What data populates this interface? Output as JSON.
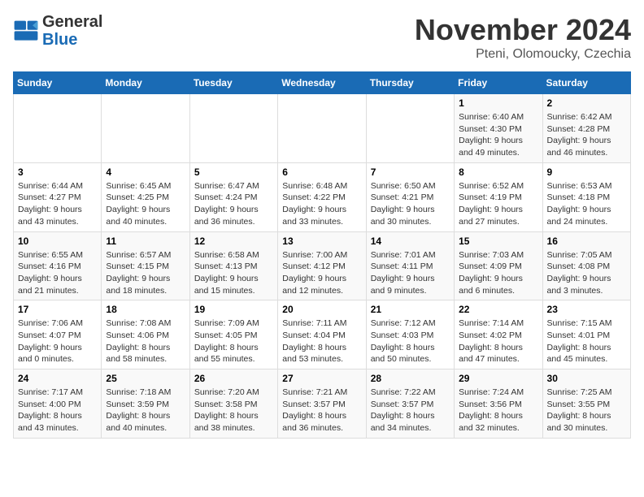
{
  "header": {
    "logo_line1": "General",
    "logo_line2": "Blue",
    "month": "November 2024",
    "location": "Pteni, Olomoucky, Czechia"
  },
  "days_of_week": [
    "Sunday",
    "Monday",
    "Tuesday",
    "Wednesday",
    "Thursday",
    "Friday",
    "Saturday"
  ],
  "weeks": [
    [
      {
        "day": "",
        "detail": ""
      },
      {
        "day": "",
        "detail": ""
      },
      {
        "day": "",
        "detail": ""
      },
      {
        "day": "",
        "detail": ""
      },
      {
        "day": "",
        "detail": ""
      },
      {
        "day": "1",
        "detail": "Sunrise: 6:40 AM\nSunset: 4:30 PM\nDaylight: 9 hours\nand 49 minutes."
      },
      {
        "day": "2",
        "detail": "Sunrise: 6:42 AM\nSunset: 4:28 PM\nDaylight: 9 hours\nand 46 minutes."
      }
    ],
    [
      {
        "day": "3",
        "detail": "Sunrise: 6:44 AM\nSunset: 4:27 PM\nDaylight: 9 hours\nand 43 minutes."
      },
      {
        "day": "4",
        "detail": "Sunrise: 6:45 AM\nSunset: 4:25 PM\nDaylight: 9 hours\nand 40 minutes."
      },
      {
        "day": "5",
        "detail": "Sunrise: 6:47 AM\nSunset: 4:24 PM\nDaylight: 9 hours\nand 36 minutes."
      },
      {
        "day": "6",
        "detail": "Sunrise: 6:48 AM\nSunset: 4:22 PM\nDaylight: 9 hours\nand 33 minutes."
      },
      {
        "day": "7",
        "detail": "Sunrise: 6:50 AM\nSunset: 4:21 PM\nDaylight: 9 hours\nand 30 minutes."
      },
      {
        "day": "8",
        "detail": "Sunrise: 6:52 AM\nSunset: 4:19 PM\nDaylight: 9 hours\nand 27 minutes."
      },
      {
        "day": "9",
        "detail": "Sunrise: 6:53 AM\nSunset: 4:18 PM\nDaylight: 9 hours\nand 24 minutes."
      }
    ],
    [
      {
        "day": "10",
        "detail": "Sunrise: 6:55 AM\nSunset: 4:16 PM\nDaylight: 9 hours\nand 21 minutes."
      },
      {
        "day": "11",
        "detail": "Sunrise: 6:57 AM\nSunset: 4:15 PM\nDaylight: 9 hours\nand 18 minutes."
      },
      {
        "day": "12",
        "detail": "Sunrise: 6:58 AM\nSunset: 4:13 PM\nDaylight: 9 hours\nand 15 minutes."
      },
      {
        "day": "13",
        "detail": "Sunrise: 7:00 AM\nSunset: 4:12 PM\nDaylight: 9 hours\nand 12 minutes."
      },
      {
        "day": "14",
        "detail": "Sunrise: 7:01 AM\nSunset: 4:11 PM\nDaylight: 9 hours\nand 9 minutes."
      },
      {
        "day": "15",
        "detail": "Sunrise: 7:03 AM\nSunset: 4:09 PM\nDaylight: 9 hours\nand 6 minutes."
      },
      {
        "day": "16",
        "detail": "Sunrise: 7:05 AM\nSunset: 4:08 PM\nDaylight: 9 hours\nand 3 minutes."
      }
    ],
    [
      {
        "day": "17",
        "detail": "Sunrise: 7:06 AM\nSunset: 4:07 PM\nDaylight: 9 hours\nand 0 minutes."
      },
      {
        "day": "18",
        "detail": "Sunrise: 7:08 AM\nSunset: 4:06 PM\nDaylight: 8 hours\nand 58 minutes."
      },
      {
        "day": "19",
        "detail": "Sunrise: 7:09 AM\nSunset: 4:05 PM\nDaylight: 8 hours\nand 55 minutes."
      },
      {
        "day": "20",
        "detail": "Sunrise: 7:11 AM\nSunset: 4:04 PM\nDaylight: 8 hours\nand 53 minutes."
      },
      {
        "day": "21",
        "detail": "Sunrise: 7:12 AM\nSunset: 4:03 PM\nDaylight: 8 hours\nand 50 minutes."
      },
      {
        "day": "22",
        "detail": "Sunrise: 7:14 AM\nSunset: 4:02 PM\nDaylight: 8 hours\nand 47 minutes."
      },
      {
        "day": "23",
        "detail": "Sunrise: 7:15 AM\nSunset: 4:01 PM\nDaylight: 8 hours\nand 45 minutes."
      }
    ],
    [
      {
        "day": "24",
        "detail": "Sunrise: 7:17 AM\nSunset: 4:00 PM\nDaylight: 8 hours\nand 43 minutes."
      },
      {
        "day": "25",
        "detail": "Sunrise: 7:18 AM\nSunset: 3:59 PM\nDaylight: 8 hours\nand 40 minutes."
      },
      {
        "day": "26",
        "detail": "Sunrise: 7:20 AM\nSunset: 3:58 PM\nDaylight: 8 hours\nand 38 minutes."
      },
      {
        "day": "27",
        "detail": "Sunrise: 7:21 AM\nSunset: 3:57 PM\nDaylight: 8 hours\nand 36 minutes."
      },
      {
        "day": "28",
        "detail": "Sunrise: 7:22 AM\nSunset: 3:57 PM\nDaylight: 8 hours\nand 34 minutes."
      },
      {
        "day": "29",
        "detail": "Sunrise: 7:24 AM\nSunset: 3:56 PM\nDaylight: 8 hours\nand 32 minutes."
      },
      {
        "day": "30",
        "detail": "Sunrise: 7:25 AM\nSunset: 3:55 PM\nDaylight: 8 hours\nand 30 minutes."
      }
    ]
  ]
}
